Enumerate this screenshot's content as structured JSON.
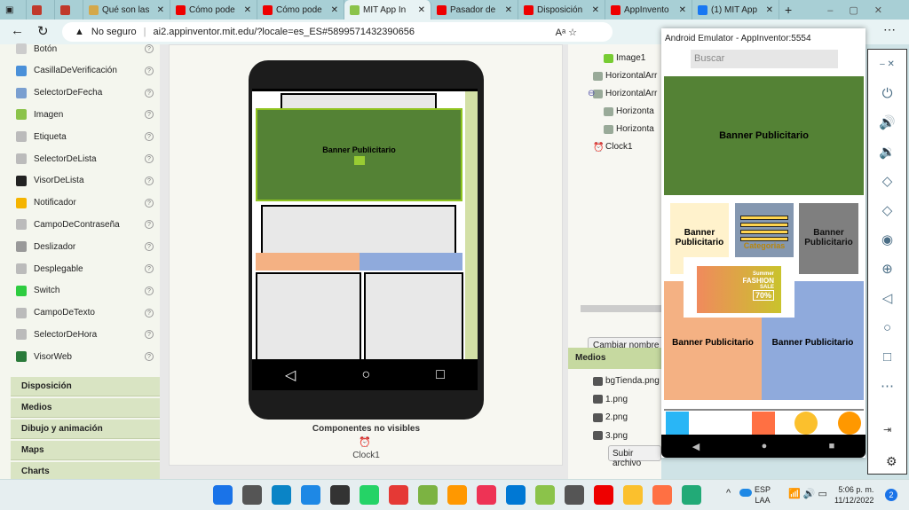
{
  "browser": {
    "tabs": [
      {
        "label": "",
        "color": "#c0392b"
      },
      {
        "label": "",
        "color": "#c0392b"
      },
      {
        "label": "Qué son las",
        "color": "#d4a84a"
      },
      {
        "label": "Cómo pode",
        "color": "#e00"
      },
      {
        "label": "Cómo pode",
        "color": "#e00"
      },
      {
        "label": "MIT App In",
        "color": "#8bc34a",
        "active": true
      },
      {
        "label": "Pasador de",
        "color": "#e00"
      },
      {
        "label": "Disposición",
        "color": "#e00"
      },
      {
        "label": "AppInvento",
        "color": "#e00"
      },
      {
        "label": "(1) MIT App",
        "color": "#1877f2"
      }
    ],
    "security": "No seguro",
    "url": "ai2.appinventor.mit.edu/?locale=es_ES#5899571432390656"
  },
  "palette": {
    "items": [
      "Botón",
      "CasillaDeVerificación",
      "SelectorDeFecha",
      "Imagen",
      "Etiqueta",
      "SelectorDeLista",
      "VisorDeLista",
      "Notificador",
      "CampoDeContraseña",
      "Deslizador",
      "Desplegable",
      "Switch",
      "CampoDeTexto",
      "SelectorDeHora",
      "VisorWeb"
    ],
    "categories": [
      "Disposición",
      "Medios",
      "Dibujo y animación",
      "Maps",
      "Charts"
    ]
  },
  "viewer": {
    "banner": "Banner Publicitario",
    "nonvisible_label": "Componentes no visibles",
    "clock": "Clock1"
  },
  "tree": {
    "items": [
      "Image1",
      "HorizontalArr",
      "HorizontalArr",
      "Horizonta",
      "Horizonta",
      "Clock1"
    ],
    "rename_button": "Cambiar nombre"
  },
  "media": {
    "title": "Medios",
    "files": [
      "bgTienda.png",
      "1.png",
      "2.png",
      "3.png"
    ],
    "upload_button": "Subir archivo"
  },
  "emulator": {
    "title": "Android Emulator - AppInventor:5554",
    "search_placeholder": "Buscar",
    "banner": "Banner Publicitario",
    "categories_label": "Categorias",
    "promo": {
      "line1": "Summer",
      "line2": "FASHION",
      "line3": "SALE",
      "discount": "70%"
    },
    "colors": {
      "green": "#548235",
      "cream": "#fff2cc",
      "slate": "#8497b0",
      "gray": "#7f7f7f",
      "peach": "#f4b183",
      "blue": "#8faadc"
    }
  },
  "taskbar": {
    "lang1": "ESP",
    "lang2": "LAA",
    "time": "5:06 p. m.",
    "date": "11/12/2022",
    "notifications": "2"
  }
}
